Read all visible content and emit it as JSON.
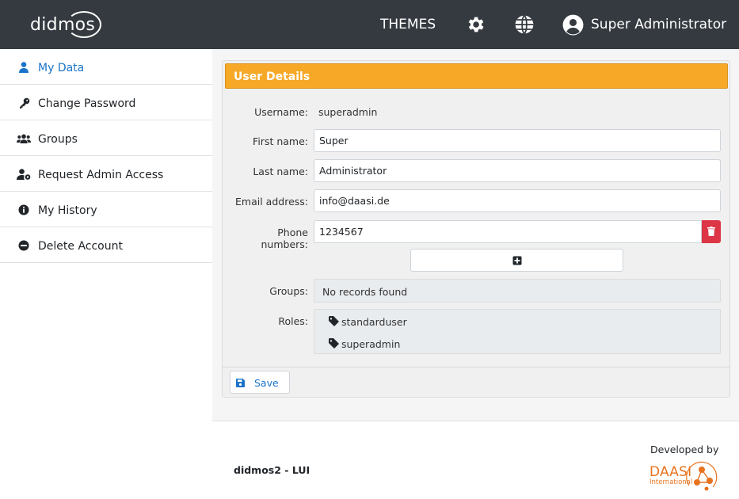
{
  "header": {
    "logo_text": "didmos",
    "themes_label": "THEMES",
    "settings_icon": "gear-icon",
    "language_icon": "globe-icon",
    "user_icon": "user-circle-icon",
    "user_name": "Super Administrator",
    "background": "#343a40"
  },
  "sidebar": {
    "items": [
      {
        "label": "My Data",
        "icon": "user-icon",
        "active": true
      },
      {
        "label": "Change Password",
        "icon": "key-icon"
      },
      {
        "label": "Groups",
        "icon": "users-icon"
      },
      {
        "label": "Request Admin Access",
        "icon": "user-cog-icon"
      },
      {
        "label": "My History",
        "icon": "info-circle-icon"
      },
      {
        "label": "Delete Account",
        "icon": "minus-circle-icon"
      }
    ]
  },
  "user_details": {
    "title": "User Details",
    "accent_color": "#f6a826",
    "username_label": "Username:",
    "username_value": "superadmin",
    "first_name_label": "First name:",
    "first_name_value": "Super",
    "last_name_label": "Last name:",
    "last_name_value": "Administrator",
    "email_label": "Email address:",
    "email_value": "info@daasi.de",
    "phone_label_line1": "Phone",
    "phone_label_line2": "numbers:",
    "phone_value": "1234567",
    "groups_label": "Groups:",
    "groups_value": "No records found",
    "roles_label": "Roles:",
    "roles": [
      "standarduser",
      "superadmin"
    ],
    "save_label": "Save"
  },
  "footer": {
    "app_name": "didmos2 - LUI",
    "developed_by": "Developed by",
    "company_logo_text": "DAASI",
    "company_logo_sub": "International"
  }
}
